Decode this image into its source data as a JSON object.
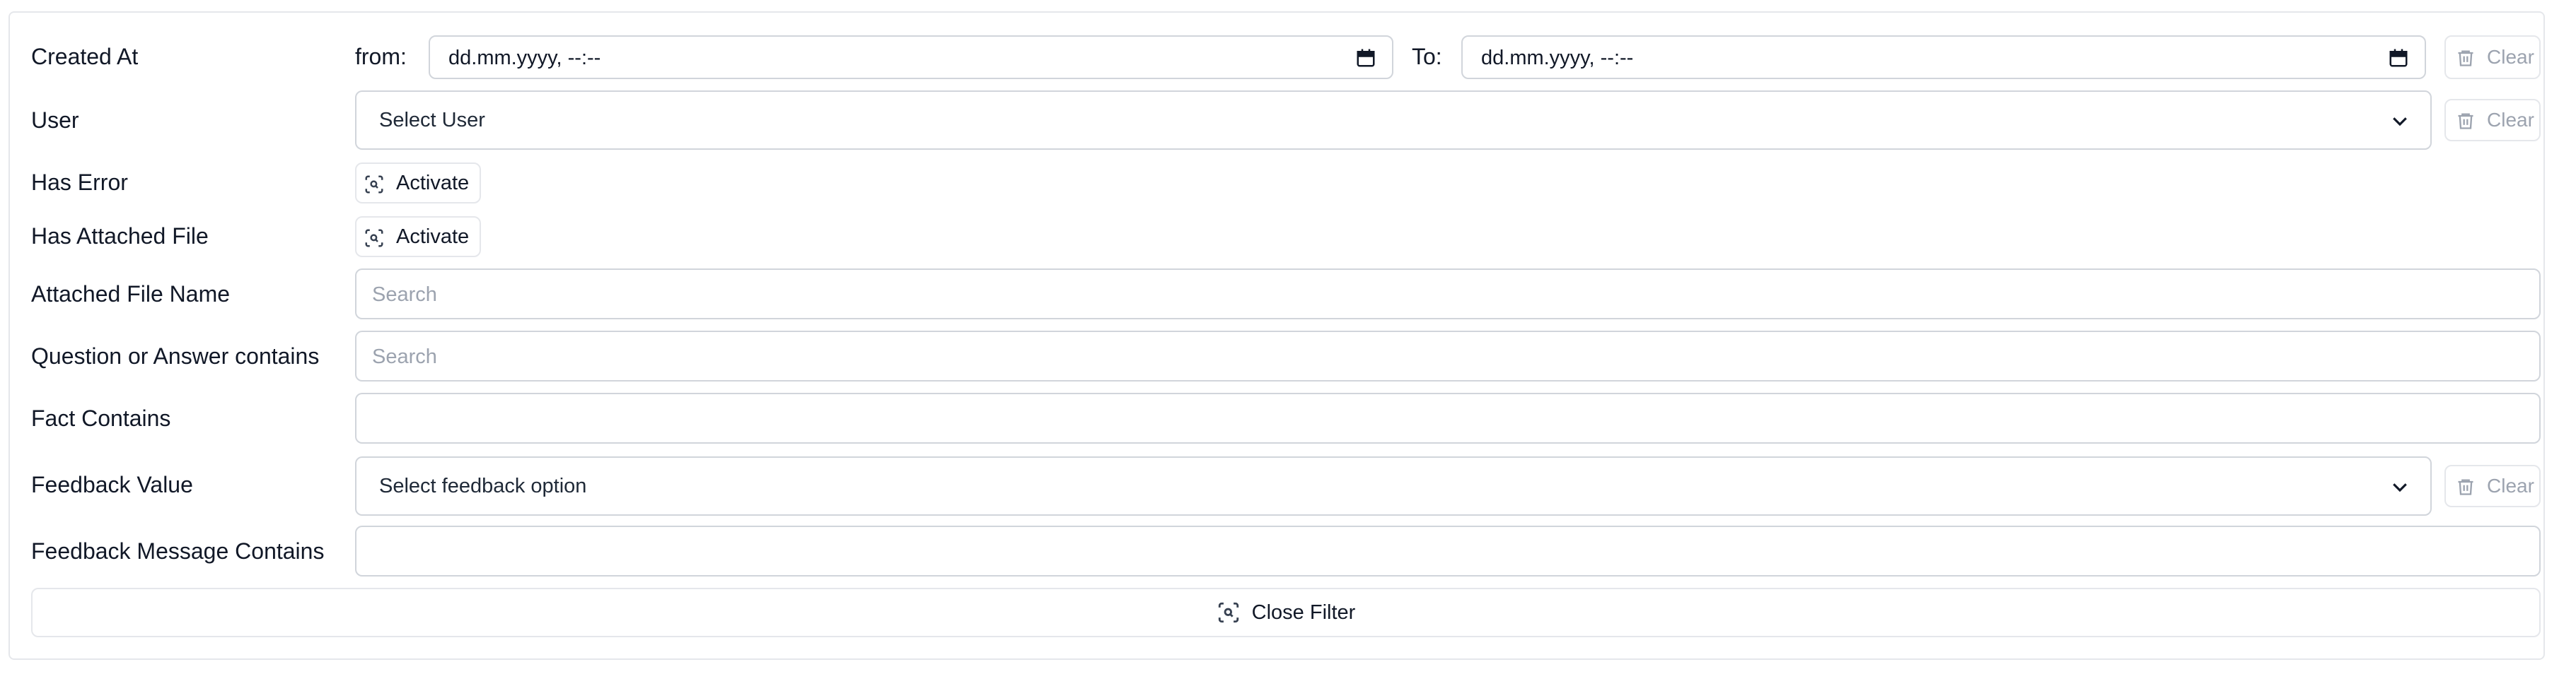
{
  "filters": {
    "created_at": {
      "label": "Created At",
      "from_label": "from:",
      "to_label": "To:",
      "from_value": "dd.mm.yyyy, --:--",
      "to_value": "dd.mm.yyyy, --:--",
      "clear_label": "Clear"
    },
    "user": {
      "label": "User",
      "placeholder": "Select User",
      "clear_label": "Clear"
    },
    "has_error": {
      "label": "Has Error",
      "button_label": "Activate"
    },
    "has_attached_file": {
      "label": "Has Attached File",
      "button_label": "Activate"
    },
    "attached_file_name": {
      "label": "Attached File Name",
      "placeholder": "Search"
    },
    "question_or_answer": {
      "label": "Question or Answer contains",
      "placeholder": "Search"
    },
    "fact_contains": {
      "label": "Fact Contains",
      "value": ""
    },
    "feedback_value": {
      "label": "Feedback Value",
      "placeholder": "Select feedback option",
      "clear_label": "Clear"
    },
    "feedback_message": {
      "label": "Feedback Message Contains",
      "value": ""
    }
  },
  "footer": {
    "close_filter_label": "Close Filter"
  },
  "icons": {
    "calendar": "calendar-icon",
    "trash": "trash-icon",
    "chevron": "chevron-down-icon",
    "scan": "scan-search-icon"
  },
  "colors": {
    "border": "#d1d5db",
    "muted_text": "#9ca3af",
    "text": "#111827"
  }
}
